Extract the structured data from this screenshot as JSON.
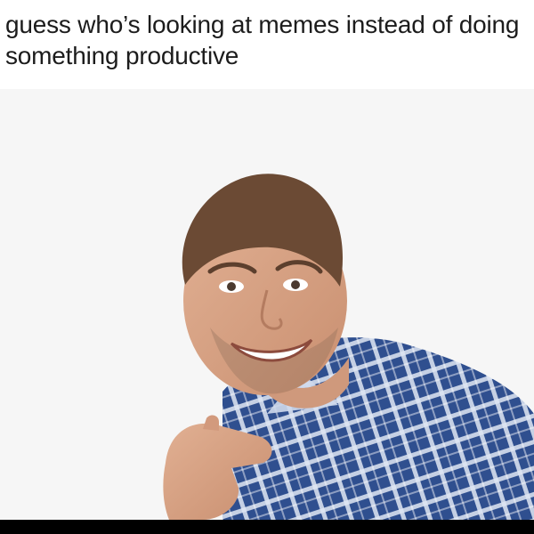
{
  "meme": {
    "caption": "guess who’s looking at memes instead of doing something productive"
  },
  "photo": {
    "subject": "smiling-man-pointing",
    "colors": {
      "background": "#f6f6f6",
      "shirt_blue": "#2f4f8f",
      "shirt_light": "#dfe7f3",
      "skin": "#d7a384",
      "hair": "#6b4a34"
    }
  }
}
